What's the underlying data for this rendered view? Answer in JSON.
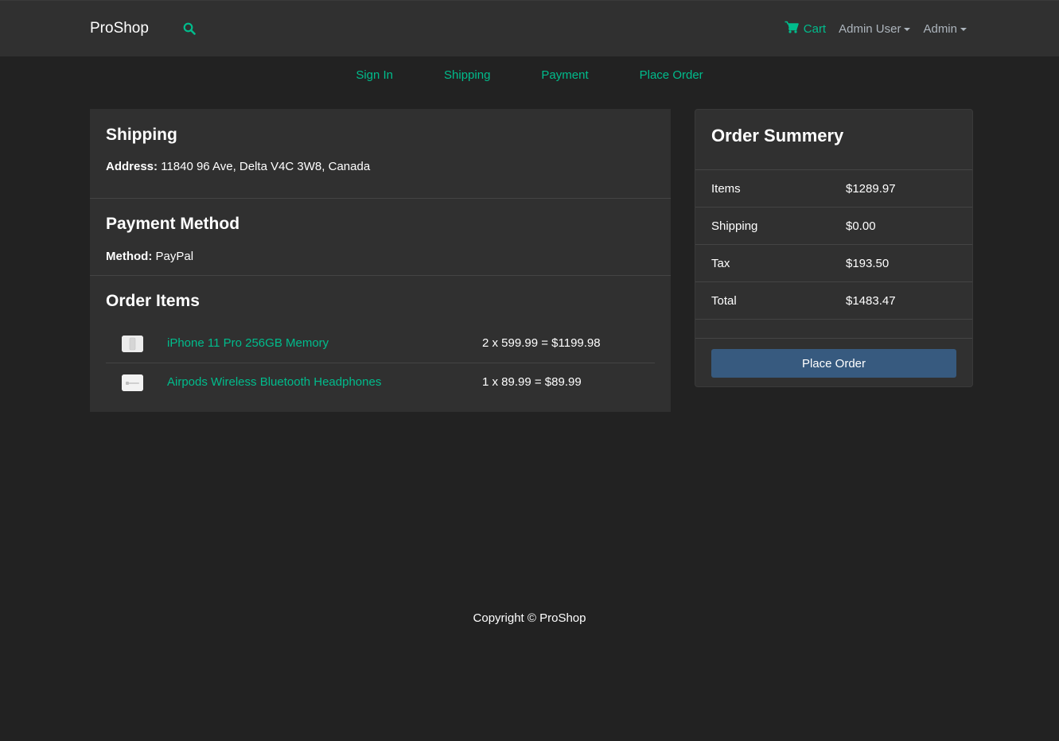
{
  "navbar": {
    "brand": "ProShop",
    "search_icon": "search-icon",
    "cart_icon": "shopping-cart-icon",
    "cart_label": "Cart",
    "user_menu": "Admin User",
    "admin_menu": "Admin"
  },
  "steps": [
    "Sign In",
    "Shipping",
    "Payment",
    "Place Order"
  ],
  "shipping": {
    "title": "Shipping",
    "label": "Address:",
    "value": "11840 96 Ave, Delta V4C 3W8, Canada"
  },
  "payment": {
    "title": "Payment Method",
    "label": "Method:",
    "value": "PayPal"
  },
  "order_items": {
    "title": "Order Items",
    "items": [
      {
        "name": "iPhone 11 Pro 256GB Memory",
        "calc": "2 x 599.99 = $1199.98"
      },
      {
        "name": "Airpods Wireless Bluetooth Headphones",
        "calc": "1 x 89.99 = $89.99"
      }
    ]
  },
  "summary": {
    "title": "Order Summery",
    "rows": [
      {
        "label": "Items",
        "value": "$1289.97"
      },
      {
        "label": "Shipping",
        "value": "$0.00"
      },
      {
        "label": "Tax",
        "value": "$193.50"
      },
      {
        "label": "Total",
        "value": "$1483.47"
      }
    ],
    "button": "Place Order"
  },
  "footer": "Copyright © ProShop",
  "colors": {
    "background": "#222222",
    "navbar": "#303030",
    "accent": "#00bc8c",
    "primary_button": "#375a7f",
    "muted": "#adb5bd"
  }
}
